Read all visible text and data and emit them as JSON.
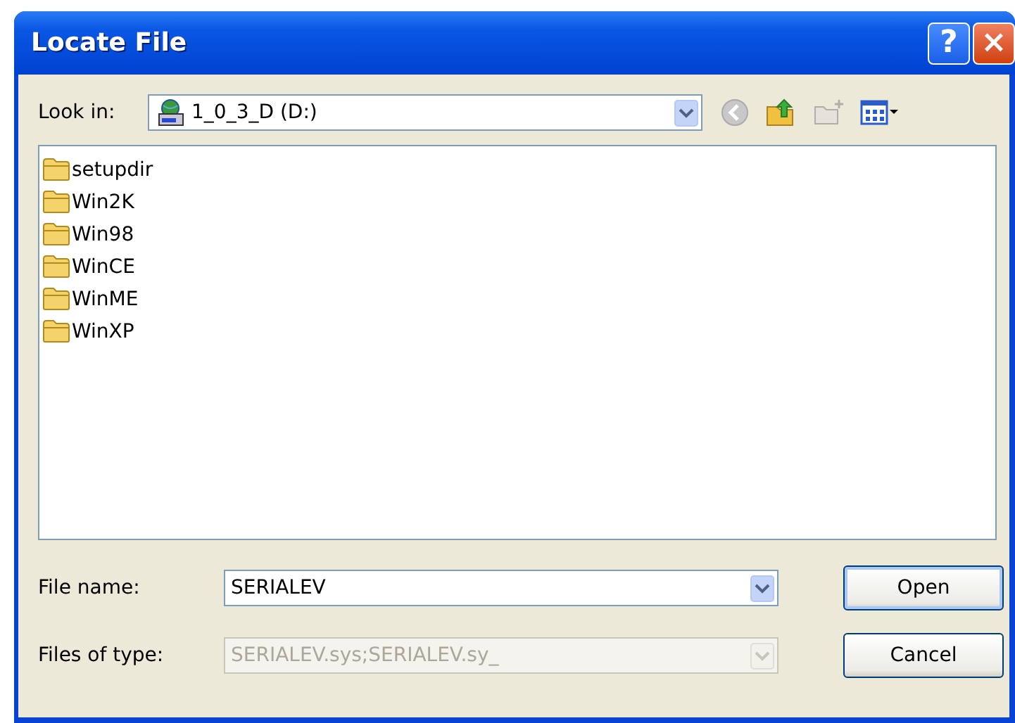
{
  "window": {
    "title": "Locate File",
    "title_buttons": [
      {
        "kind": "help",
        "label": "?"
      },
      {
        "kind": "close",
        "label": "×"
      }
    ]
  },
  "look_in": {
    "label": "Look in:",
    "value": "1_0_3_D (D:)"
  },
  "toolbar": [
    {
      "kind": "back",
      "disabled": true
    },
    {
      "kind": "up",
      "disabled": false
    },
    {
      "kind": "new-folder",
      "disabled": true
    },
    {
      "kind": "views",
      "disabled": false
    }
  ],
  "files": [
    {
      "name": "setupdir"
    },
    {
      "name": "Win2K"
    },
    {
      "name": "Win98"
    },
    {
      "name": "WinCE"
    },
    {
      "name": "WinME"
    },
    {
      "name": "WinXP"
    }
  ],
  "file_name": {
    "label": "File name:",
    "value": "SERIALEV",
    "disabled": false
  },
  "file_type": {
    "label": "Files of type:",
    "value": "SERIALEV.sys;SERIALEV.sy_",
    "disabled": true
  },
  "buttons": [
    {
      "label": "Open",
      "default": true
    },
    {
      "label": "Cancel",
      "default": false
    }
  ]
}
